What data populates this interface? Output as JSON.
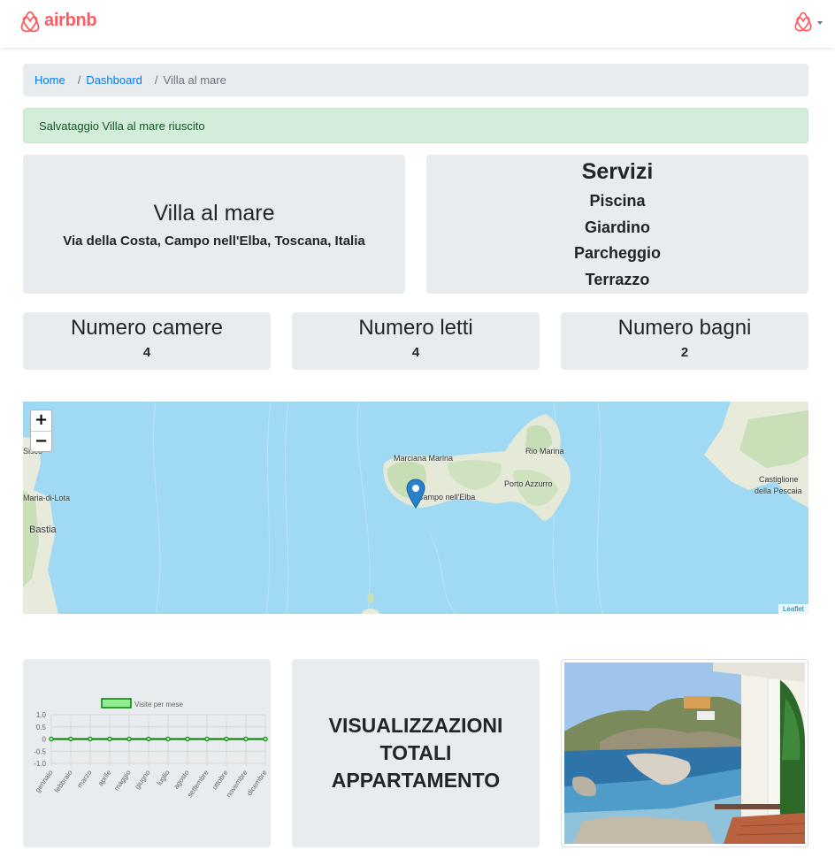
{
  "navbar": {
    "logo_text": "airbnb",
    "logo_icon": "airbnb-logo-icon",
    "user_icon": "airbnb-user-icon",
    "brand_color": "#ff5a5f"
  },
  "breadcrumb": {
    "home": "Home",
    "dashboard": "Dashboard",
    "current": "Villa al mare",
    "separator": "/"
  },
  "alert": {
    "message": "Salvataggio Villa al mare riuscito"
  },
  "apartment": {
    "title": "Villa al mare",
    "address": "Via della Costa, Campo nell'Elba, Toscana, Italia"
  },
  "services": {
    "title": "Servizi",
    "items": [
      "Piscina",
      "Giardino",
      "Parcheggio",
      "Terrazzo"
    ]
  },
  "stats": {
    "rooms": {
      "label": "Numero camere",
      "value": "4"
    },
    "beds": {
      "label": "Numero letti",
      "value": "4"
    },
    "bathrooms": {
      "label": "Numero bagni",
      "value": "2"
    }
  },
  "map": {
    "zoom_in": "+",
    "zoom_out": "−",
    "attribution": "Leaflet",
    "marker_icon": "map-marker-icon",
    "places": {
      "marciana_marina": "Marciana Marina",
      "rio_marina": "Rio Marina",
      "porto_azzurro": "Porto Azzurro",
      "campo_elba": "Campo nell'Elba",
      "castiglione": "Castiglione",
      "della_pescaia": "della Pescaia",
      "bastia": "Bastia",
      "maria_di_lota": "Maria-di-Lota",
      "sisco": "Sisco"
    }
  },
  "views": {
    "title": "VISUALIZZAZIONI TOTALI APPARTAMENTO"
  },
  "chart_data": {
    "type": "line",
    "categories": [
      "gennaio",
      "febbraio",
      "marzo",
      "aprile",
      "maggio",
      "giugno",
      "luglio",
      "agosto",
      "settembre",
      "ottobre",
      "novembre",
      "dicembre"
    ],
    "series": [
      {
        "name": "Visite per mese",
        "values": [
          0,
          0,
          0,
          0,
          0,
          0,
          0,
          0,
          0,
          0,
          0,
          0
        ],
        "color": "#008000",
        "fill": "#90ee90"
      }
    ],
    "yticks": [
      "1.0",
      "0.5",
      "0",
      "-0.5",
      "-1.0"
    ],
    "ylim": [
      -1,
      1
    ],
    "grid": true,
    "legend": "top"
  }
}
